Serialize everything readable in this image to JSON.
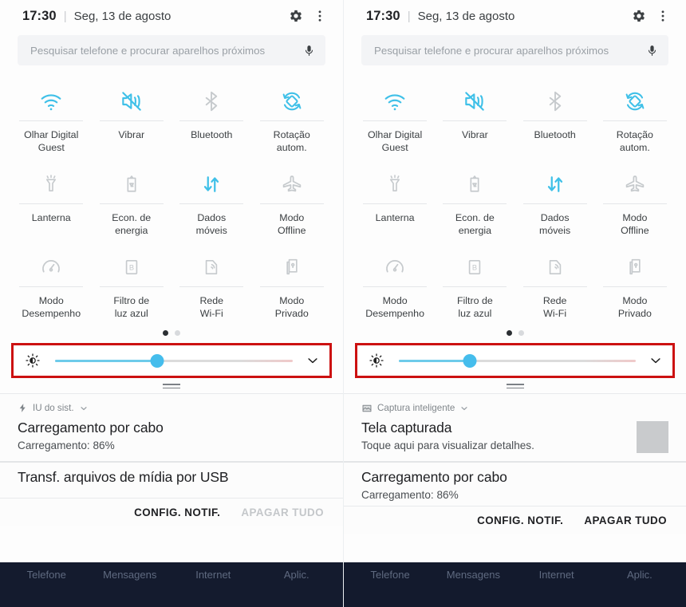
{
  "header": {
    "time": "17:30",
    "separator": "|",
    "date": "Seg, 13 de agosto",
    "settings_icon": "gear-icon",
    "overflow_icon": "more-vertical-icon"
  },
  "search": {
    "placeholder": "Pesquisar telefone e procurar aparelhos próximos",
    "mic_icon": "microphone-icon"
  },
  "quick_settings": {
    "rows": [
      [
        {
          "label": "Olhar Digital\nGuest",
          "icon": "wifi-icon",
          "state": "on"
        },
        {
          "label": "Vibrar",
          "icon": "volume-vibrate-icon",
          "state": "on"
        },
        {
          "label": "Bluetooth",
          "icon": "bluetooth-icon",
          "state": "off"
        },
        {
          "label": "Rotação\nautom.",
          "icon": "auto-rotate-icon",
          "state": "on"
        }
      ],
      [
        {
          "label": "Lanterna",
          "icon": "flashlight-icon",
          "state": "off"
        },
        {
          "label": "Econ. de\nenergia",
          "icon": "battery-saver-icon",
          "state": "off"
        },
        {
          "label": "Dados\nmóveis",
          "icon": "mobile-data-icon",
          "state": "on"
        },
        {
          "label": "Modo\nOffline",
          "icon": "airplane-mode-icon",
          "state": "off"
        }
      ],
      [
        {
          "label": "Modo\nDesempenho",
          "icon": "performance-mode-icon",
          "state": "off"
        },
        {
          "label": "Filtro de\nluz azul",
          "icon": "blue-light-filter-icon",
          "state": "off"
        },
        {
          "label": "Rede\nWi-Fi",
          "icon": "wifi-hotspot-icon",
          "state": "off"
        },
        {
          "label": "Modo\nPrivado",
          "icon": "private-mode-icon",
          "state": "off"
        }
      ]
    ],
    "pages": 2,
    "active_page": 1
  },
  "brightness": {
    "icon": "brightness-icon",
    "expand_icon": "chevron-down-icon",
    "highlight_color": "#cc1111",
    "track_active_color": "#6ecbea",
    "thumb_color": "#45bdec",
    "left_value_percent": 43,
    "right_value_percent": 30
  },
  "notifications": {
    "left": [
      {
        "app": "IU do sist.",
        "app_icon": "bolt-icon",
        "expand_icon": "chevron-down-icon",
        "title": "Carregamento por cabo",
        "body": "Carregamento: 86%",
        "thumbnail": false
      },
      {
        "app": "",
        "app_icon": "",
        "expand_icon": "",
        "title": "Transf. arquivos de mídia por USB",
        "body": "",
        "thumbnail": false
      }
    ],
    "right": [
      {
        "app": "Captura inteligente",
        "app_icon": "image-icon",
        "expand_icon": "chevron-down-icon",
        "title": "Tela capturada",
        "body": "Toque aqui para visualizar detalhes.",
        "thumbnail": true
      },
      {
        "app": "",
        "app_icon": "",
        "expand_icon": "",
        "title": "Carregamento por cabo",
        "body": "Carregamento: 86%",
        "thumbnail": false
      }
    ]
  },
  "actions": {
    "settings_label": "CONFIG. NOTIF.",
    "clear_label": "APAGAR TUDO"
  },
  "navbar": {
    "items": [
      "Telefone",
      "Mensagens",
      "Internet",
      "Aplic."
    ]
  }
}
